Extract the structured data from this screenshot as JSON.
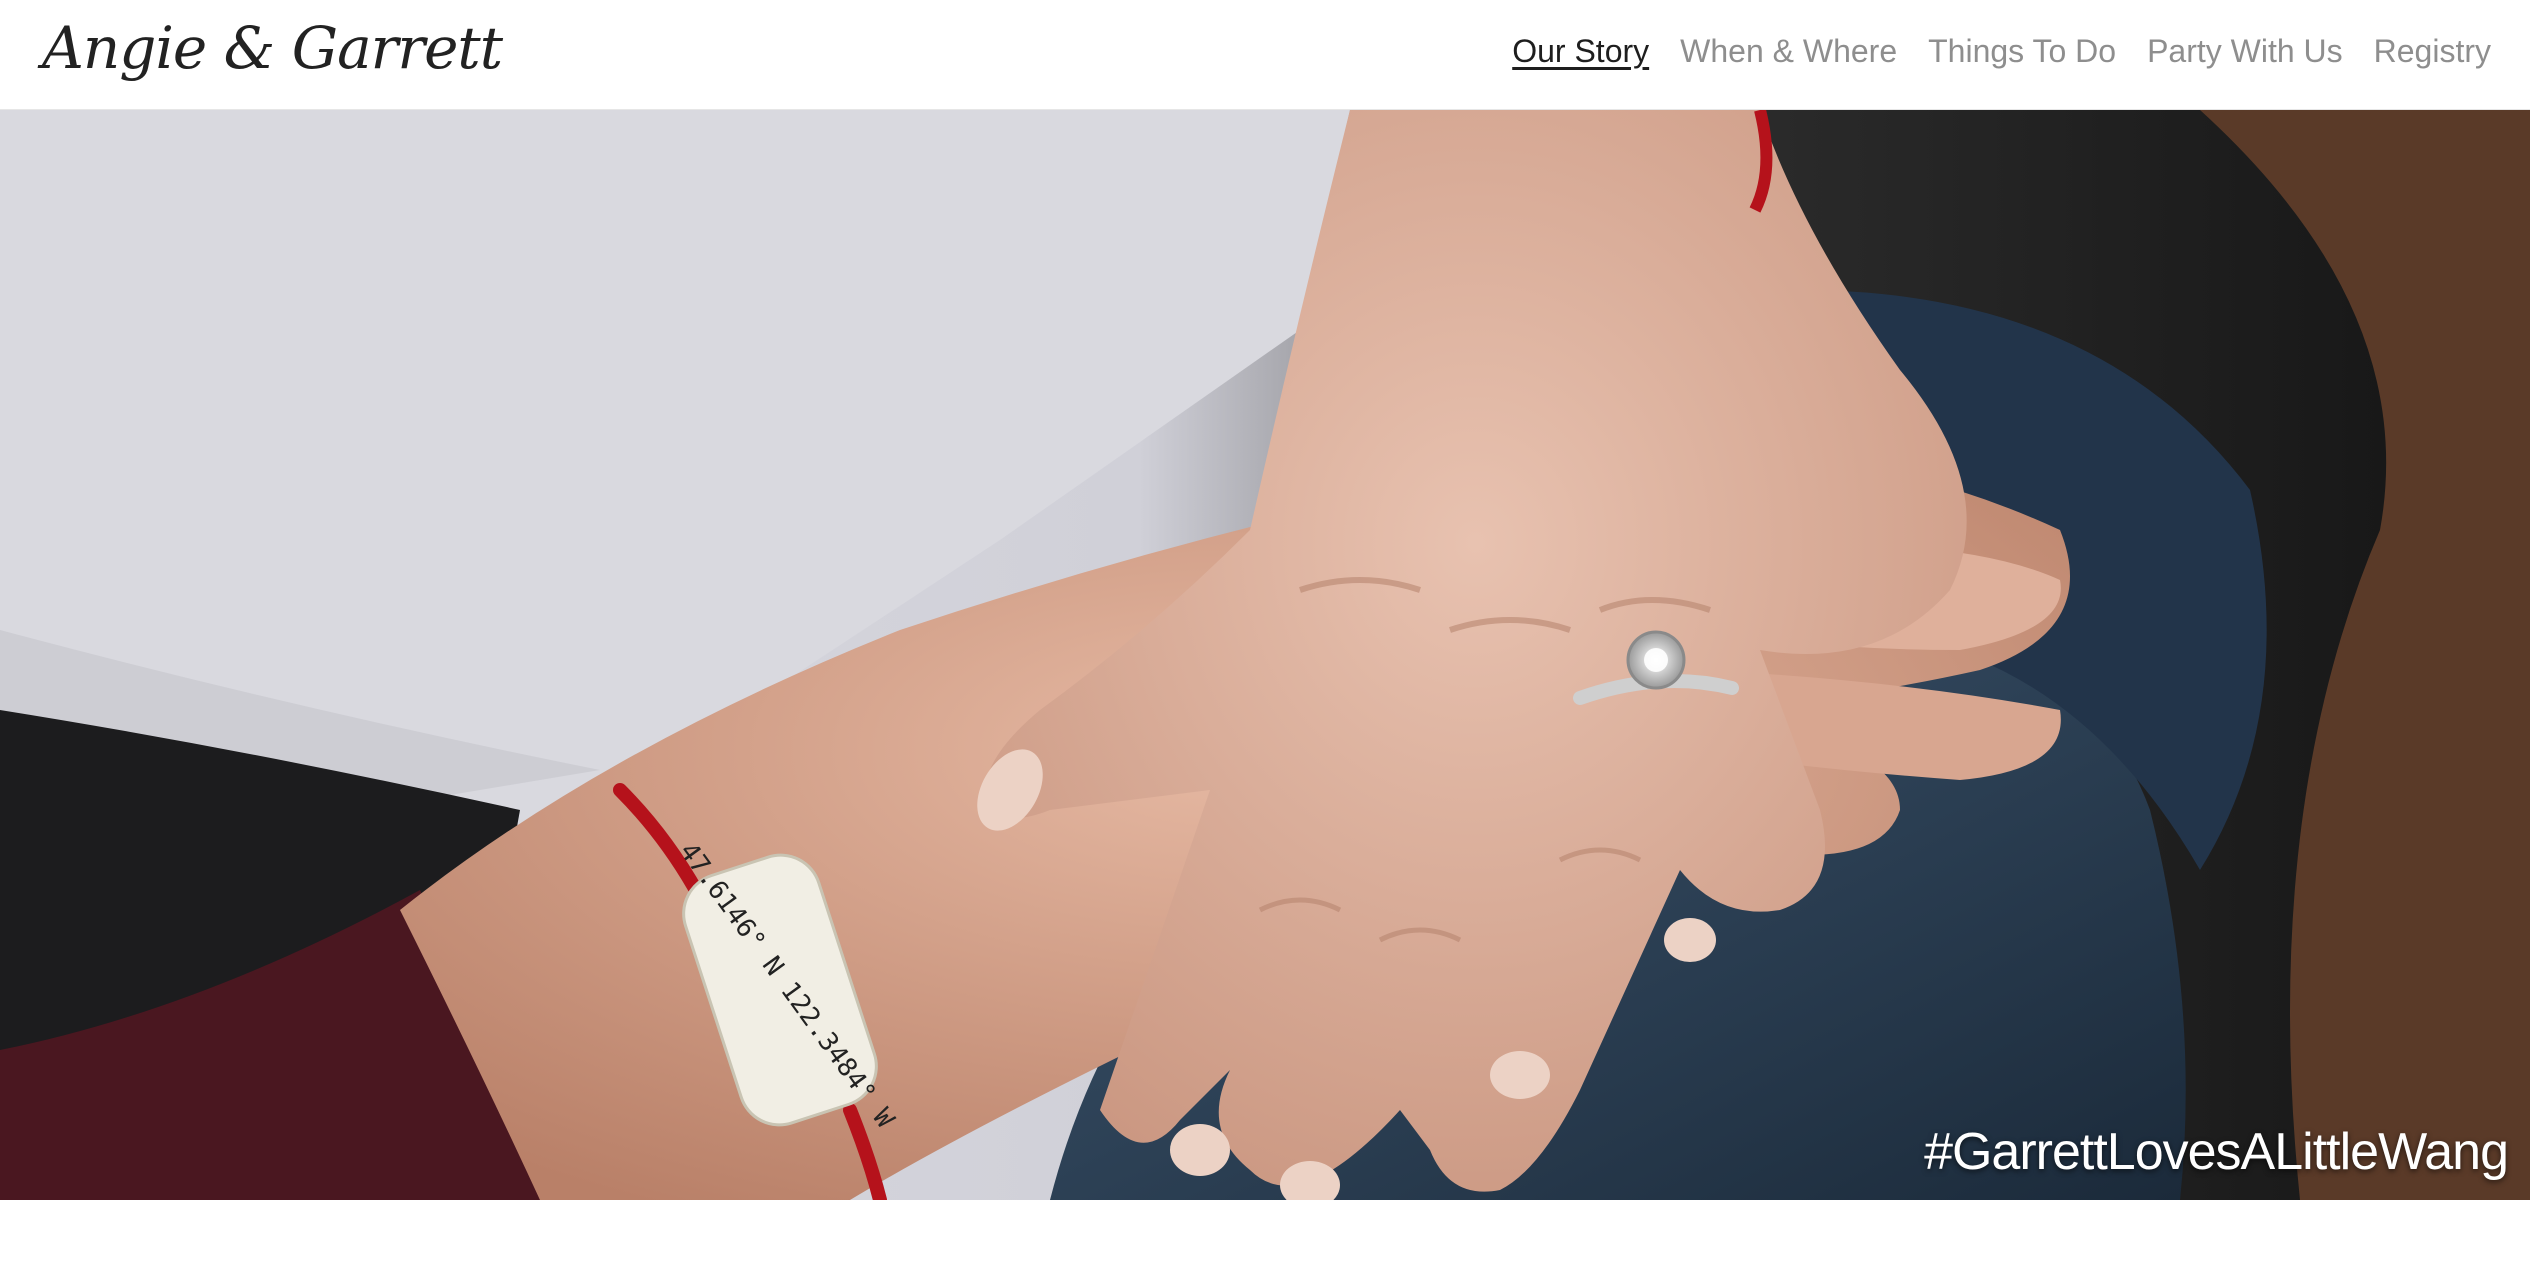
{
  "site": {
    "logo_text": "Angie & Garrett"
  },
  "nav": {
    "items": [
      {
        "label": "Our Story",
        "active": true
      },
      {
        "label": "When & Where",
        "active": false
      },
      {
        "label": "Things To Do",
        "active": false
      },
      {
        "label": "Party With Us",
        "active": false
      },
      {
        "label": "Registry",
        "active": false
      }
    ]
  },
  "hero": {
    "image": "engagement-photo-hands-ring-bracelet",
    "hashtag": "#GarrettLovesALittleWang",
    "bracelet_text": "47.6146° N 122.3484° W"
  },
  "colors": {
    "active_link": "#1e1e1e",
    "link": "#8e8e8e",
    "bracelet_cord": "#b5121b"
  }
}
